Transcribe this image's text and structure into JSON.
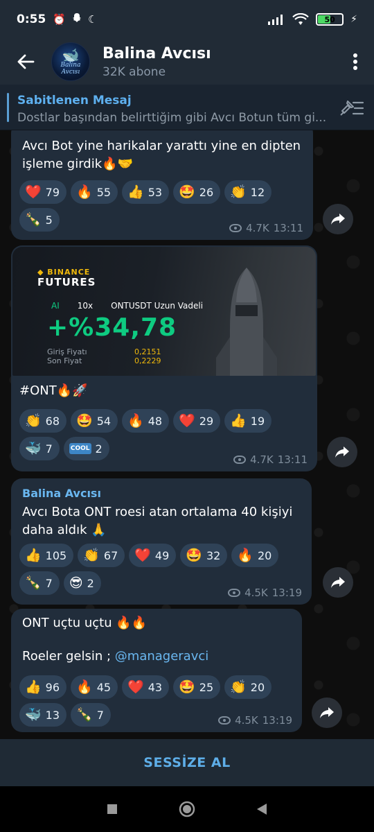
{
  "status_bar": {
    "time": "0:55",
    "battery": "50",
    "battery_level": 0.5,
    "icons": [
      "alarm-icon",
      "snapchat-icon",
      "moon-icon",
      "signal-icon",
      "wifi-icon",
      "battery-icon",
      "charging-icon"
    ]
  },
  "header": {
    "channel_name": "Balina Avcısı",
    "subscribers": "32K abone",
    "avatar_text": "Balina Avcısı"
  },
  "pinned": {
    "title": "Sabitlenen Mesaj",
    "text": "Dostlar başından belirttiğim gibi Avcı Botun tüm gi..."
  },
  "messages": [
    {
      "text": "Avcı Bot yine harikalar yarattı yine en dipten işleme girdik🔥🤝",
      "reactions": [
        {
          "emoji": "❤️",
          "count": "79"
        },
        {
          "emoji": "🔥",
          "count": "55"
        },
        {
          "emoji": "👍",
          "count": "53"
        },
        {
          "emoji": "🤩",
          "count": "26"
        },
        {
          "emoji": "👏",
          "count": "12"
        },
        {
          "emoji": "🍾",
          "count": "5"
        }
      ],
      "views": "4.7K",
      "time": "13:11"
    },
    {
      "card": {
        "brand": "BINANCE",
        "product": "FUTURES",
        "mode": "AI",
        "leverage": "10x",
        "pair": "ONTUSDT Uzun Vadeli",
        "pnl": "+%34,78",
        "entry_label": "Giriş Fiyatı",
        "entry_value": "0,2151",
        "last_label": "Son Fiyat",
        "last_value": "0,2229"
      },
      "text": "#ONT🔥🚀",
      "reactions": [
        {
          "emoji": "👏",
          "count": "68"
        },
        {
          "emoji": "🤩",
          "count": "54"
        },
        {
          "emoji": "🔥",
          "count": "48"
        },
        {
          "emoji": "❤️",
          "count": "29"
        },
        {
          "emoji": "👍",
          "count": "19"
        },
        {
          "emoji": "🐳",
          "count": "7"
        },
        {
          "emoji": "COOL",
          "count": "2"
        }
      ],
      "views": "4.7K",
      "time": "13:11"
    },
    {
      "sender": "Balina Avcısı",
      "text": "Avcı Bota ONT roesi atan ortalama 40 kişiyi daha aldık 🙏",
      "reactions": [
        {
          "emoji": "👍",
          "count": "105"
        },
        {
          "emoji": "👏",
          "count": "67"
        },
        {
          "emoji": "❤️",
          "count": "49"
        },
        {
          "emoji": "🤩",
          "count": "32"
        },
        {
          "emoji": "🔥",
          "count": "20"
        },
        {
          "emoji": "🍾",
          "count": "7"
        },
        {
          "emoji": "😎",
          "count": "2"
        }
      ],
      "views": "4.5K",
      "time": "13:19"
    },
    {
      "text_line1": "ONT uçtu uçtu 🔥🔥",
      "text_line2_prefix": "Roeler gelsin ; ",
      "mention": "@manageravci",
      "reactions": [
        {
          "emoji": "👍",
          "count": "96"
        },
        {
          "emoji": "🔥",
          "count": "45"
        },
        {
          "emoji": "❤️",
          "count": "43"
        },
        {
          "emoji": "🤩",
          "count": "25"
        },
        {
          "emoji": "👏",
          "count": "20"
        },
        {
          "emoji": "🐳",
          "count": "13"
        },
        {
          "emoji": "🍾",
          "count": "7"
        }
      ],
      "views": "4.5K",
      "time": "13:19"
    }
  ],
  "bottom": {
    "mute_label": "SESSİZE AL"
  },
  "colors": {
    "header_bg": "#212b36",
    "bubble_bg": "#212d3b",
    "reaction_bg": "#2f4257",
    "accent": "#5eaee8",
    "profit_green": "#0ecb81",
    "binance_yellow": "#f0b90b"
  }
}
